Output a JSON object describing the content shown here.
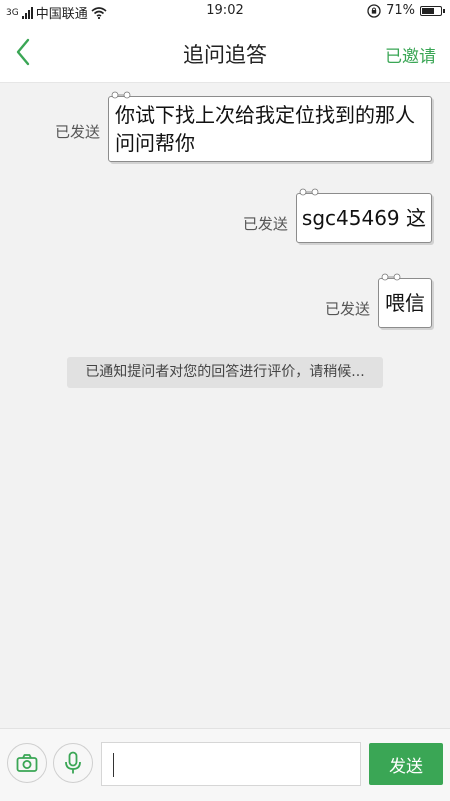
{
  "status_bar": {
    "network_type": "3G",
    "carrier": "中国联通",
    "time": "19:02",
    "battery_percent": "71%",
    "battery_level": 0.71,
    "icons": [
      "signal-icon",
      "wifi-icon",
      "rotation-lock-icon",
      "battery-icon"
    ]
  },
  "header": {
    "title": "追问追答",
    "invite_label": "已邀请",
    "back_icon": "chevron-left-icon"
  },
  "messages": [
    {
      "text": "你试下找上次给我定位找到的那人问问帮你",
      "status": "已发送"
    },
    {
      "text": "sgc45469 这",
      "status": "已发送"
    },
    {
      "text": "喂信",
      "status": "已发送"
    }
  ],
  "notice": "已通知提问者对您的回答进行评价，请稍候...",
  "input_bar": {
    "camera_icon": "camera-icon",
    "mic_icon": "microphone-icon",
    "input_value": "",
    "send_label": "发送"
  },
  "colors": {
    "accent": "#3aa655",
    "background": "#f2f2f2",
    "notice_bg": "#e1e1e1"
  }
}
